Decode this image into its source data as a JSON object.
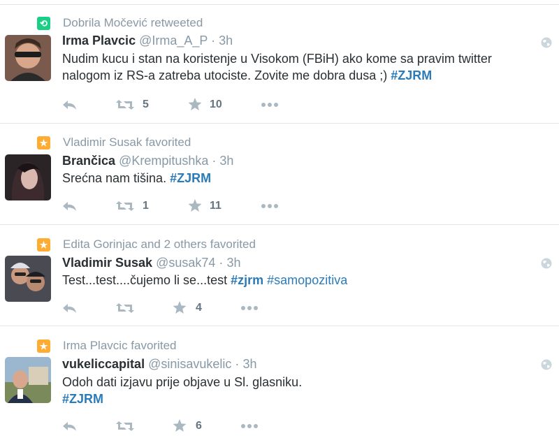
{
  "tweets": [
    {
      "context": "Dobrila Močević retweeted",
      "context_icon": "retweet-icon",
      "name": "Irma Plavcic",
      "handle": "@Irma_A_P",
      "time": "3h",
      "text_lines": [
        "Nudim kucu i stan na koristenje u Visokom (FBiH) ako kome sa pravim twitter",
        "nalogom iz RS-a zatreba utociste. Zovite me dobra dusa ;)"
      ],
      "hashtag": "#ZJRM",
      "retweets": "5",
      "favorites": "10"
    },
    {
      "context": "Vladimir Susak favorited",
      "context_icon": "star-icon",
      "name": "Brančica",
      "handle": "@Krempitushka",
      "time": "3h",
      "text_lines": [
        "Srećna nam tišina."
      ],
      "hashtag": "#ZJRM",
      "retweets": "1",
      "favorites": "11"
    },
    {
      "context": "Edita Gorinjac and 2 others favorited",
      "context_icon": "star-icon",
      "name": "Vladimir Susak",
      "handle": "@susak74",
      "time": "3h",
      "text_lines": [
        "Test...test....čujemo li se...test"
      ],
      "hashtag": "#zjrm",
      "hashtag2": "#samopozitiva",
      "retweets": "",
      "favorites": "4"
    },
    {
      "context": "Irma Plavcic favorited",
      "context_icon": "star-icon",
      "name": "vukeliccapital",
      "handle": "@sinisavukelic",
      "time": "3h",
      "text_lines": [
        "Odoh dati izjavu prije objave u Sl. glasniku."
      ],
      "hashtag": "#ZJRM",
      "retweets": "",
      "favorites": "6"
    }
  ],
  "separator": "·",
  "colors": {
    "link": "#2b7bb9",
    "muted": "#8899a6",
    "retweet_green": "#19cf86",
    "favorite_orange": "#ffac33"
  }
}
